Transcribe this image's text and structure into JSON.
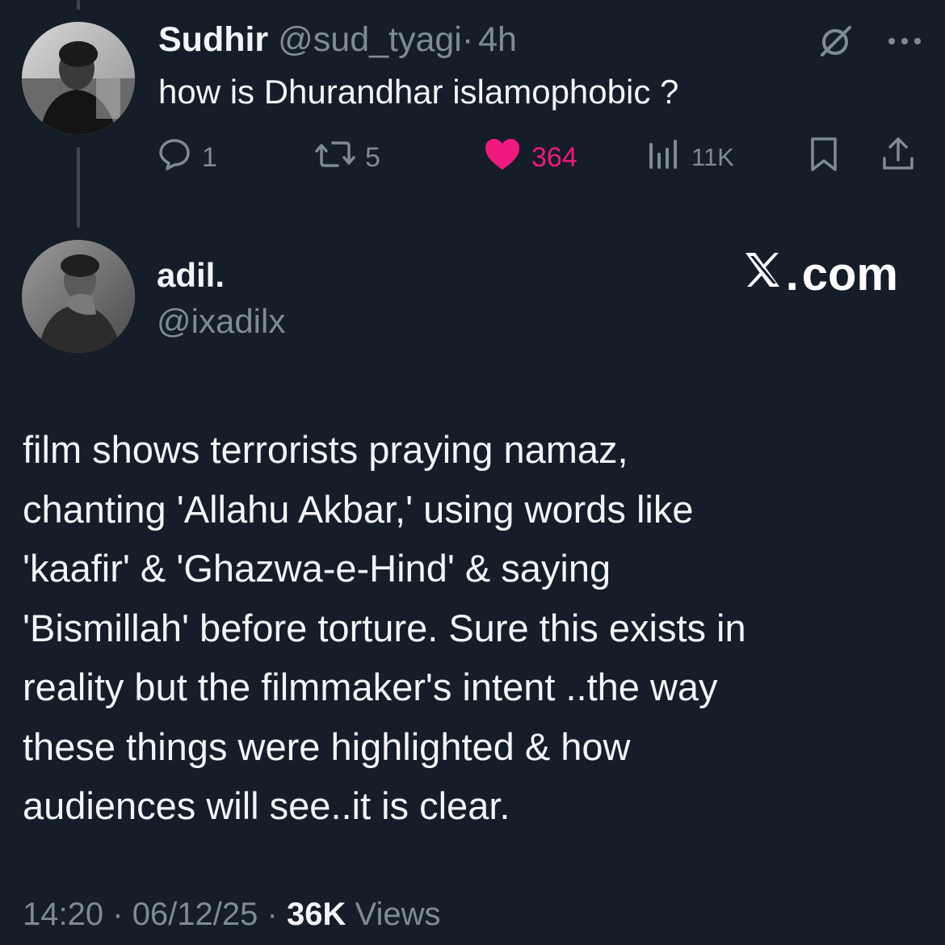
{
  "reply": {
    "author_name": "Sudhir",
    "author_handle": "@sud_tyagi",
    "separator": "·",
    "time_ago": "4h",
    "text": "how is Dhurandhar islamophobic ?",
    "actions": {
      "replies": "1",
      "reposts": "5",
      "likes": "364",
      "views": "11K"
    },
    "liked": true
  },
  "main": {
    "author_name": "adil.",
    "author_handle": "@ixadilx",
    "watermark": "com",
    "watermark_prefix": ".",
    "body_lines": [
      "film shows terrorists praying namaz,",
      "chanting 'Allahu Akbar,' using words like",
      "'kaafir' & 'Ghazwa-e-Hind' & saying",
      "'Bismillah' before torture. Sure this exists in",
      "reality but the filmmaker's intent ..the way",
      "these things were highlighted & how",
      "audiences will see..it is clear."
    ],
    "footer": {
      "time": "14:20",
      "date": "06/12/25",
      "separator": "·",
      "views_count": "36K",
      "views_label": "Views"
    }
  },
  "icons": {
    "reply": "speech-bubble-icon",
    "repost": "repost-arrows-icon",
    "like": "heart-icon",
    "views": "bar-chart-icon",
    "bookmark": "bookmark-icon",
    "share": "share-upload-icon",
    "more": "more-dots-icon",
    "grok": "grok-slash-icon",
    "x_logo": "x-logo-icon"
  },
  "colors": {
    "background": "#151d28",
    "text": "#f2f4f6",
    "muted": "#7e8b97",
    "like": "#f0197f",
    "thread_line": "#3b4754"
  }
}
